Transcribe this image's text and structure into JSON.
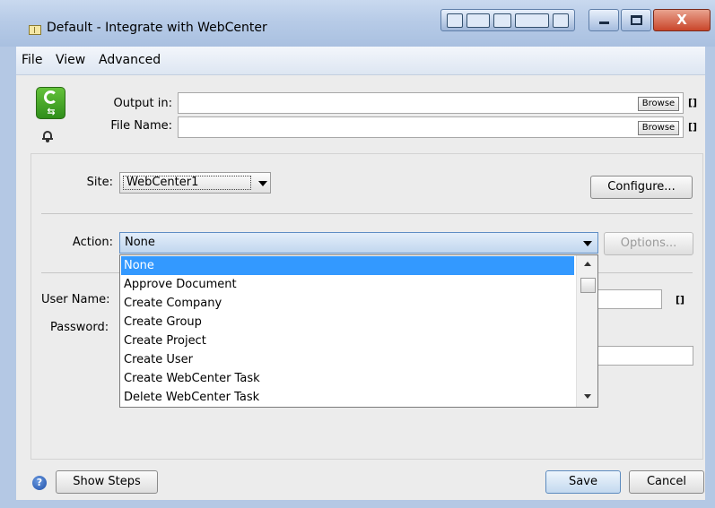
{
  "window": {
    "title": "Default - Integrate with WebCenter"
  },
  "menu": {
    "items": [
      "File",
      "View",
      "Advanced"
    ]
  },
  "output": {
    "output_in_label": "Output in:",
    "output_in_value": "",
    "file_name_label": "File Name:",
    "file_name_value": "",
    "browse_label": "Browse",
    "brackets": "[]"
  },
  "site": {
    "label": "Site:",
    "value": "WebCenter1",
    "configure_label": "Configure..."
  },
  "action": {
    "label": "Action:",
    "value": "None",
    "options_label": "Options...",
    "options_list": [
      "None",
      "Approve Document",
      "Create Company",
      "Create Group",
      "Create Project",
      "Create User",
      "Create WebCenter Task",
      "Delete WebCenter Task"
    ],
    "selected_index": 0
  },
  "credentials": {
    "user_name_label": "User Name:",
    "password_label": "Password:",
    "brackets": "[]"
  },
  "footer": {
    "help_glyph": "?",
    "show_steps_label": "Show Steps",
    "save_label": "Save",
    "cancel_label": "Cancel"
  },
  "colors": {
    "selection": "#3399ff",
    "title_bar": "#b7cbe7",
    "close_button": "#c9452a"
  },
  "icons": [
    "app-icon",
    "webcenter-logo-icon",
    "bell-icon",
    "help-icon",
    "minimize-icon",
    "maximize-icon",
    "close-icon"
  ]
}
